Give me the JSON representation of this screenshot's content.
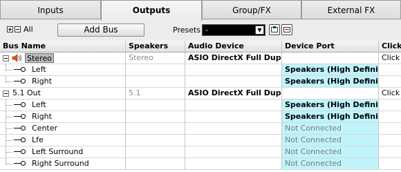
{
  "tabs": [
    {
      "label": "Inputs"
    },
    {
      "label": "Outputs"
    },
    {
      "label": "Group/FX"
    },
    {
      "label": "External FX"
    }
  ],
  "toolbar": {
    "all_label": "All",
    "add_bus_label": "Add Bus",
    "presets_label": "Presets",
    "preset_value": "-"
  },
  "table": {
    "headers": {
      "name": "Bus Name",
      "speakers": "Speakers",
      "device": "Audio Device",
      "port": "Device Port",
      "click": "Click"
    },
    "rows": [
      {
        "name": "Stereo",
        "speakers": "Stereo",
        "device": "ASIO DirectX Full Duplex",
        "port": "",
        "click": "Click"
      },
      {
        "name": "Left",
        "speakers": "",
        "device": "",
        "port": "Speakers (High Definitio",
        "click": ""
      },
      {
        "name": "Right",
        "speakers": "",
        "device": "",
        "port": "Speakers (High Definitio",
        "click": ""
      },
      {
        "name": "5.1 Out",
        "speakers": "5.1",
        "device": "ASIO DirectX Full Duplex",
        "port": "",
        "click": "Click"
      },
      {
        "name": "Left",
        "speakers": "",
        "device": "",
        "port": "Speakers (High Definitio",
        "click": ""
      },
      {
        "name": "Right",
        "speakers": "",
        "device": "",
        "port": "Speakers (High Definitio",
        "click": ""
      },
      {
        "name": "Center",
        "speakers": "",
        "device": "",
        "port": "Not Connected",
        "click": ""
      },
      {
        "name": "Lfe",
        "speakers": "",
        "device": "",
        "port": "Not Connected",
        "click": ""
      },
      {
        "name": "Left Surround",
        "speakers": "",
        "device": "",
        "port": "Not Connected",
        "click": ""
      },
      {
        "name": "Right Surround",
        "speakers": "",
        "device": "",
        "port": "Not Connected",
        "click": ""
      }
    ]
  },
  "colors": {
    "port_highlight": "#bff4fb",
    "speaker_icon": "#e05a10"
  },
  "icons": {
    "expand_all": "plus-box-icon",
    "collapse_all": "minus-box-icon",
    "preset_save": "save-preset-icon",
    "preset_remove": "remove-preset-icon",
    "bus_speaker": "speaker-icon",
    "channel_port": "output-port-icon"
  }
}
